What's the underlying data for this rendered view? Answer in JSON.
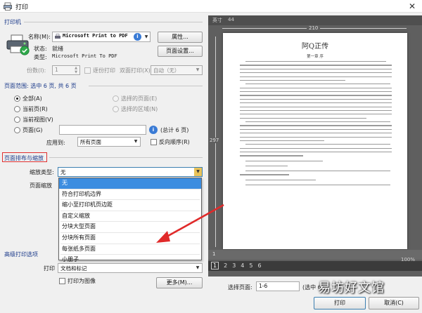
{
  "window": {
    "title": "打印",
    "close_label": "✕"
  },
  "printer": {
    "group_label": "打印机",
    "name_label": "名称(M):",
    "name_value": "Microsoft Print to PDF",
    "properties_button": "属性...",
    "status_label": "状态:",
    "status_value": "就绪",
    "type_label": "类型:",
    "type_value": "Microsoft Print To PDF",
    "page_setup_button": "页面设置...",
    "copies_label": "份数(I):",
    "copies_value": "1",
    "collate_label": "逐份打印",
    "duplex_label": "双面打印(X)",
    "duplex_value": "自动（无）"
  },
  "page_range": {
    "group_label": "页面范围: 选中 6 页, 共 6 页",
    "all_label": "全部(A)",
    "current_page_label": "当前页(R)",
    "current_view_label": "当前视图(V)",
    "pages_label": "页面(G)",
    "selected_pages_label": "选择的页面(E)",
    "selected_area_label": "选择的区域(N)",
    "total_pages_label": "(总计 6 页)",
    "apply_to_label": "应用到:",
    "apply_to_value": "所有页面",
    "reverse_label": "反向顺序(R)"
  },
  "layout_scale": {
    "group_label": "页面排布与缩放",
    "scale_type_label": "缩放类型:",
    "scale_type_value": "无",
    "page_scale_label": "页面缩放",
    "options": [
      "无",
      "符合打印机边界",
      "缩小至打印机页边距",
      "自定义缩放",
      "分块大型页面",
      "分块所有页面",
      "每张纸多页面",
      "小册子"
    ]
  },
  "advanced": {
    "group_label": "高级打印选项",
    "print_label": "打印",
    "print_value": "文档和标记",
    "print_as_image_label": "打印为图像",
    "more_button": "更多(M)..."
  },
  "preview": {
    "units_label": "英寸",
    "top_ruler_value": "44",
    "page_width_value": "210",
    "page_height_value": "297",
    "bottom_left_value": "1",
    "zoom_value": "100%",
    "page_numbers": [
      "1",
      "2",
      "3",
      "4",
      "5",
      "6"
    ],
    "current_page": "1",
    "doc_title": "阿Q正传",
    "doc_chapter": "第一章 序"
  },
  "footer": {
    "select_pages_label": "选择页面:",
    "select_pages_value": "1-6",
    "select_pages_hint": "(选中 6",
    "ok_button": "打印",
    "cancel_button": "取消(C)"
  },
  "watermark": {
    "text": "易坊好文馆"
  },
  "colors": {
    "accent_blue": "#3c8de0",
    "highlight_red": "#e03030",
    "arrow_red": "#e02a2a",
    "preview_bg": "#5f5f5f"
  }
}
